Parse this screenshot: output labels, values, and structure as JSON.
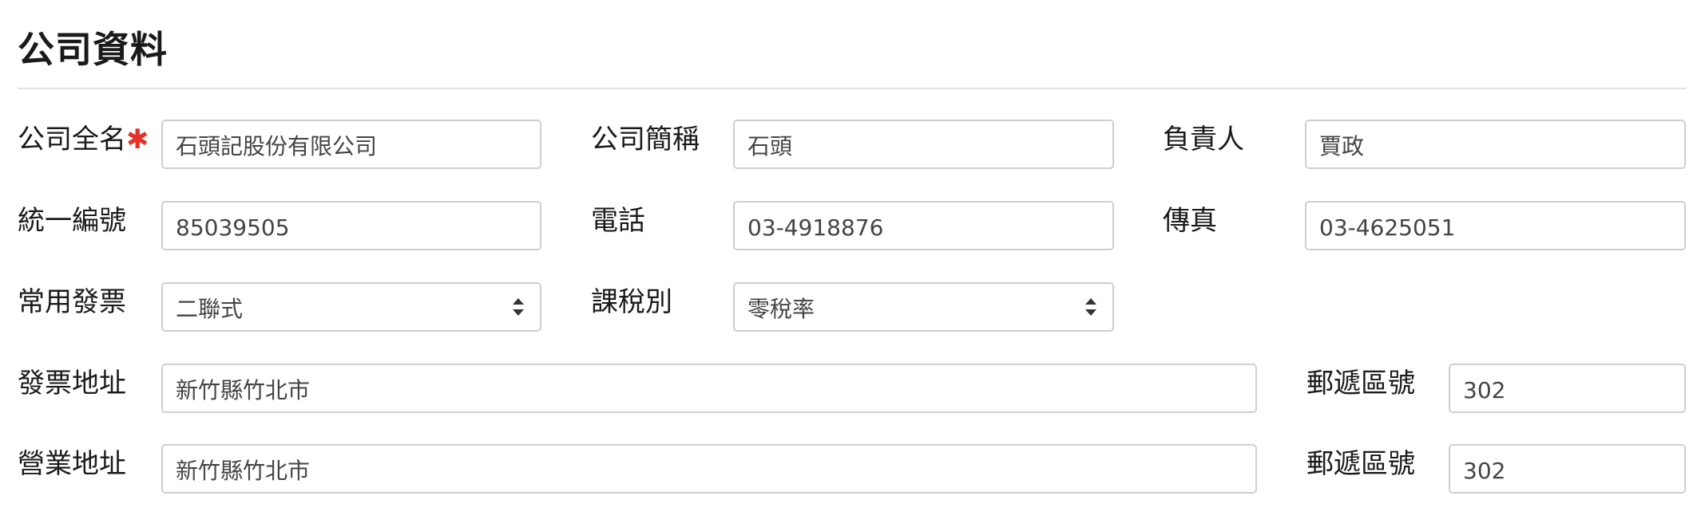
{
  "section": {
    "title": "公司資料"
  },
  "row1": {
    "full_name": {
      "label": "公司全名",
      "required_mark": "✱",
      "value": "石頭記股份有限公司"
    },
    "short_name": {
      "label": "公司簡稱",
      "value": "石頭"
    },
    "owner": {
      "label": "負責人",
      "value": "賈政"
    }
  },
  "row2": {
    "tax_id": {
      "label": "統一編號",
      "value": "85039505"
    },
    "phone": {
      "label": "電話",
      "value": "03-4918876"
    },
    "fax": {
      "label": "傳真",
      "value": "03-4625051"
    }
  },
  "row3": {
    "invoice_type": {
      "label": "常用發票",
      "value": "二聯式"
    },
    "tax_category": {
      "label": "課稅別",
      "value": "零稅率"
    }
  },
  "row4": {
    "invoice_address": {
      "label": "發票地址",
      "value": "新竹縣竹北市"
    },
    "zip": {
      "label": "郵遞區號",
      "value": "302"
    }
  },
  "row5": {
    "business_address": {
      "label": "營業地址",
      "value": "新竹縣竹北市"
    },
    "zip": {
      "label": "郵遞區號",
      "value": "302"
    }
  }
}
